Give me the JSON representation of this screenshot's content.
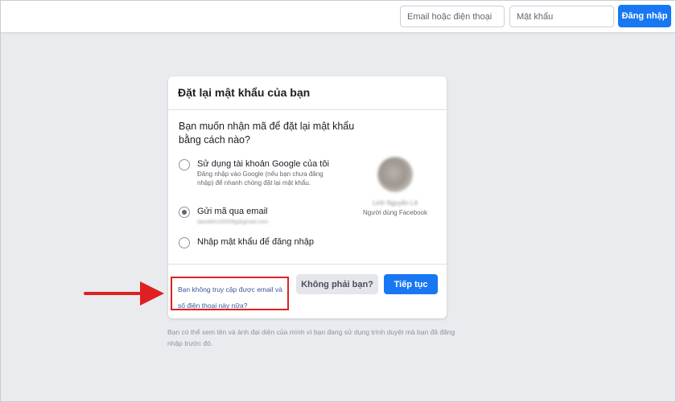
{
  "header": {
    "email_placeholder": "Email hoặc điện thoại",
    "password_placeholder": "Mật khẩu",
    "login_label": "Đăng nhập"
  },
  "card": {
    "title": "Đặt lại mật khẩu của bạn",
    "question": "Bạn muốn nhận mã để đặt lại mật khẩu bằng cách nào?",
    "options": [
      {
        "title": "Sử dụng tài khoản Google của tôi",
        "description": "Đăng nhập vào Google (nếu bạn chưa đăng nhập) để nhanh chóng đặt lại mật khẩu.",
        "selected": false
      },
      {
        "title": "Gửi mã qua email",
        "detail": "daviekh10000fg@gmail.com",
        "selected": true
      },
      {
        "title": "Nhập mật khẩu để đăng nhập",
        "selected": false
      }
    ],
    "profile": {
      "name": "Linh Nguyễn Lê",
      "subtitle": "Người dùng Facebook"
    },
    "help_link": "Bạn không truy cập được email và số điện thoại này nữa?",
    "not_you_label": "Không phải bạn?",
    "continue_label": "Tiếp tục"
  },
  "note": "Bạn có thể xem tên và ảnh đại diện của mình vì bạn đang sử dụng trình duyệt mà bạn đã đăng nhập trước đó.",
  "colors": {
    "primary": "#1877f2",
    "background": "#e9ebee",
    "annotation": "#e02020",
    "link": "#385898"
  }
}
